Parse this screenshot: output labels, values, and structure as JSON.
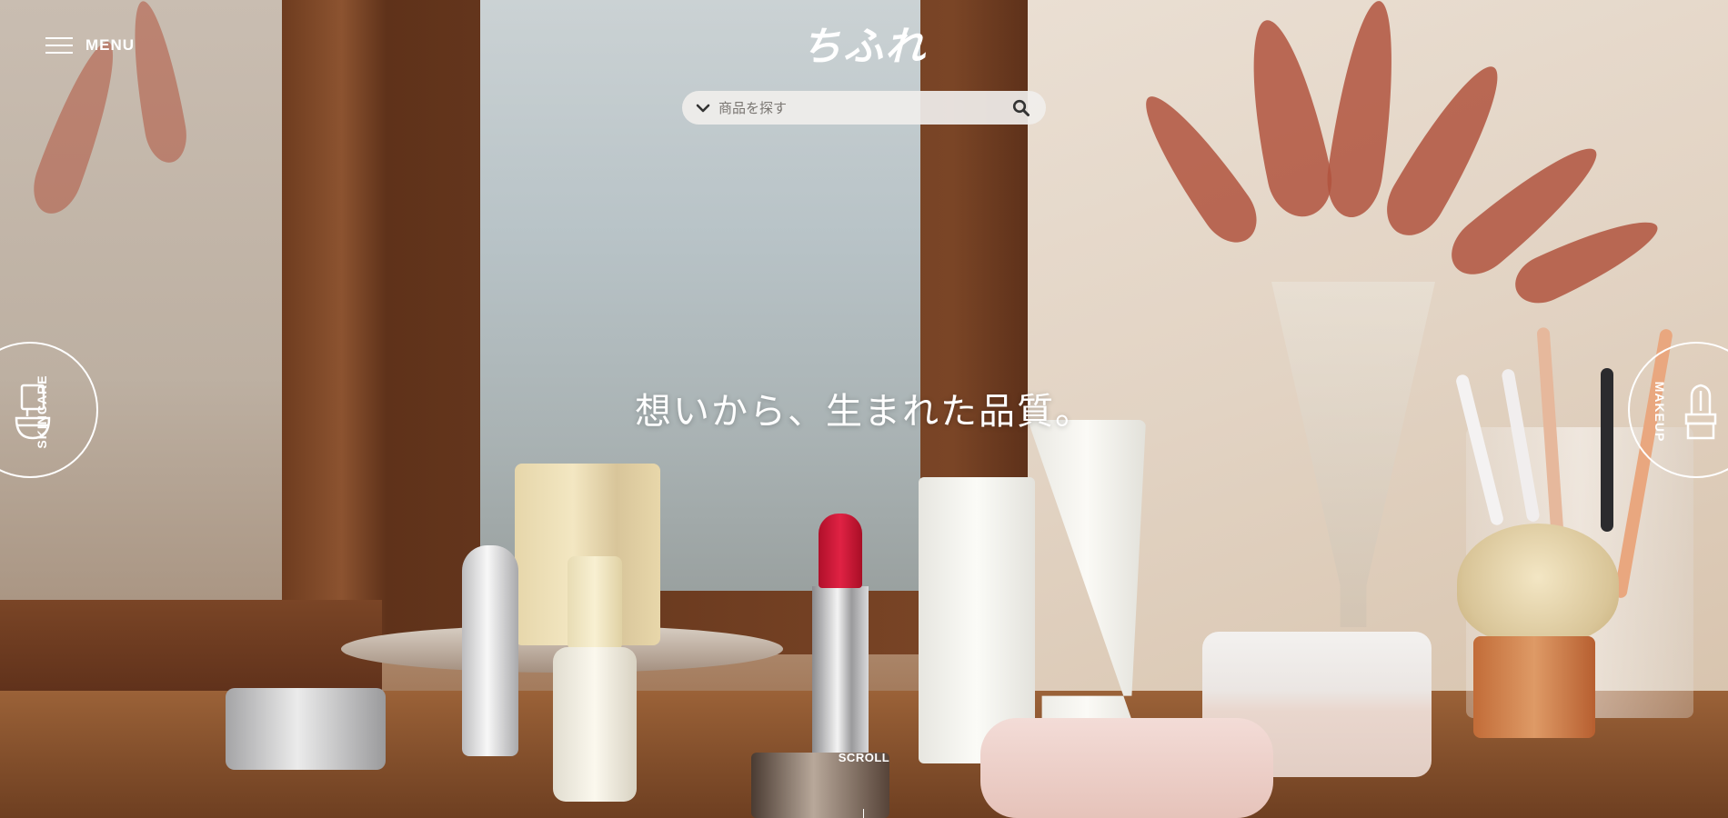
{
  "header": {
    "menu_label": "MENU",
    "logo_text": "ちふれ"
  },
  "search": {
    "placeholder": "商品を探す",
    "icon": "search-icon",
    "dropdown_icon": "chevron-down-icon"
  },
  "hero": {
    "tagline": "想いから、生まれた品質。",
    "scroll_label": "SCROLL"
  },
  "side_nav": {
    "skincare_label": "SKINCARE",
    "makeup_label": "MAKEUP"
  },
  "colors": {
    "ui_text": "#ffffff",
    "search_bg": "#f0eeeb",
    "lipstick_red": "#e02244"
  }
}
